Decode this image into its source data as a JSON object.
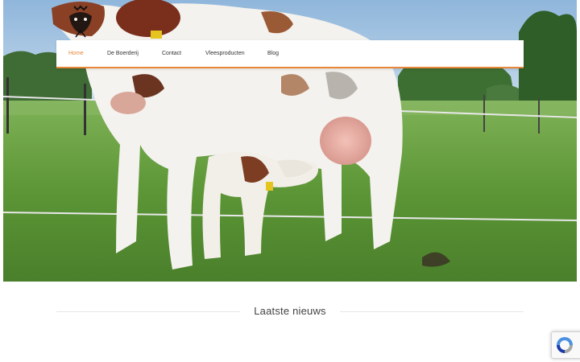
{
  "nav": {
    "items": [
      {
        "label": "Home",
        "active": true
      },
      {
        "label": "De Boerderij",
        "active": false
      },
      {
        "label": "Contact",
        "active": false
      },
      {
        "label": "Vleesproducten",
        "active": false
      },
      {
        "label": "Blog",
        "active": false
      }
    ]
  },
  "news": {
    "heading": "Laatste nieuws"
  },
  "colors": {
    "accent": "#e8873a",
    "grass": "#5f9a3a",
    "sky": "#a9c8e2"
  },
  "icons": {
    "logo": "cow-logo-icon",
    "recaptcha": "recaptcha-icon"
  }
}
